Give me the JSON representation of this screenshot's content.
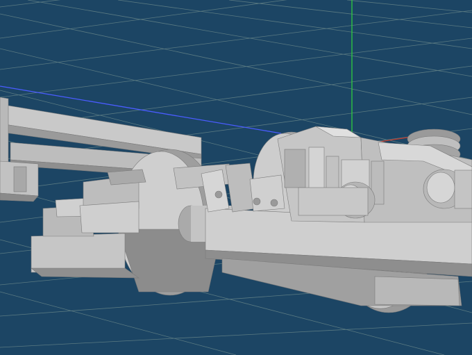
{
  "viewport": {
    "description_hidden": "",
    "colors": {
      "background": "#1c4564",
      "grid_line": "#6f8c8c",
      "axis_x": "#c0392b",
      "axis_y": "#2ecc40",
      "axis_z": "#4a5cff",
      "model_light": "#d2d2d2",
      "model_mid": "#b4b4b4",
      "model_dark": "#8c8c8c",
      "model_edge": "#7a7a7a"
    },
    "model": {
      "name": "",
      "icon": "bogie-3d-model"
    }
  }
}
